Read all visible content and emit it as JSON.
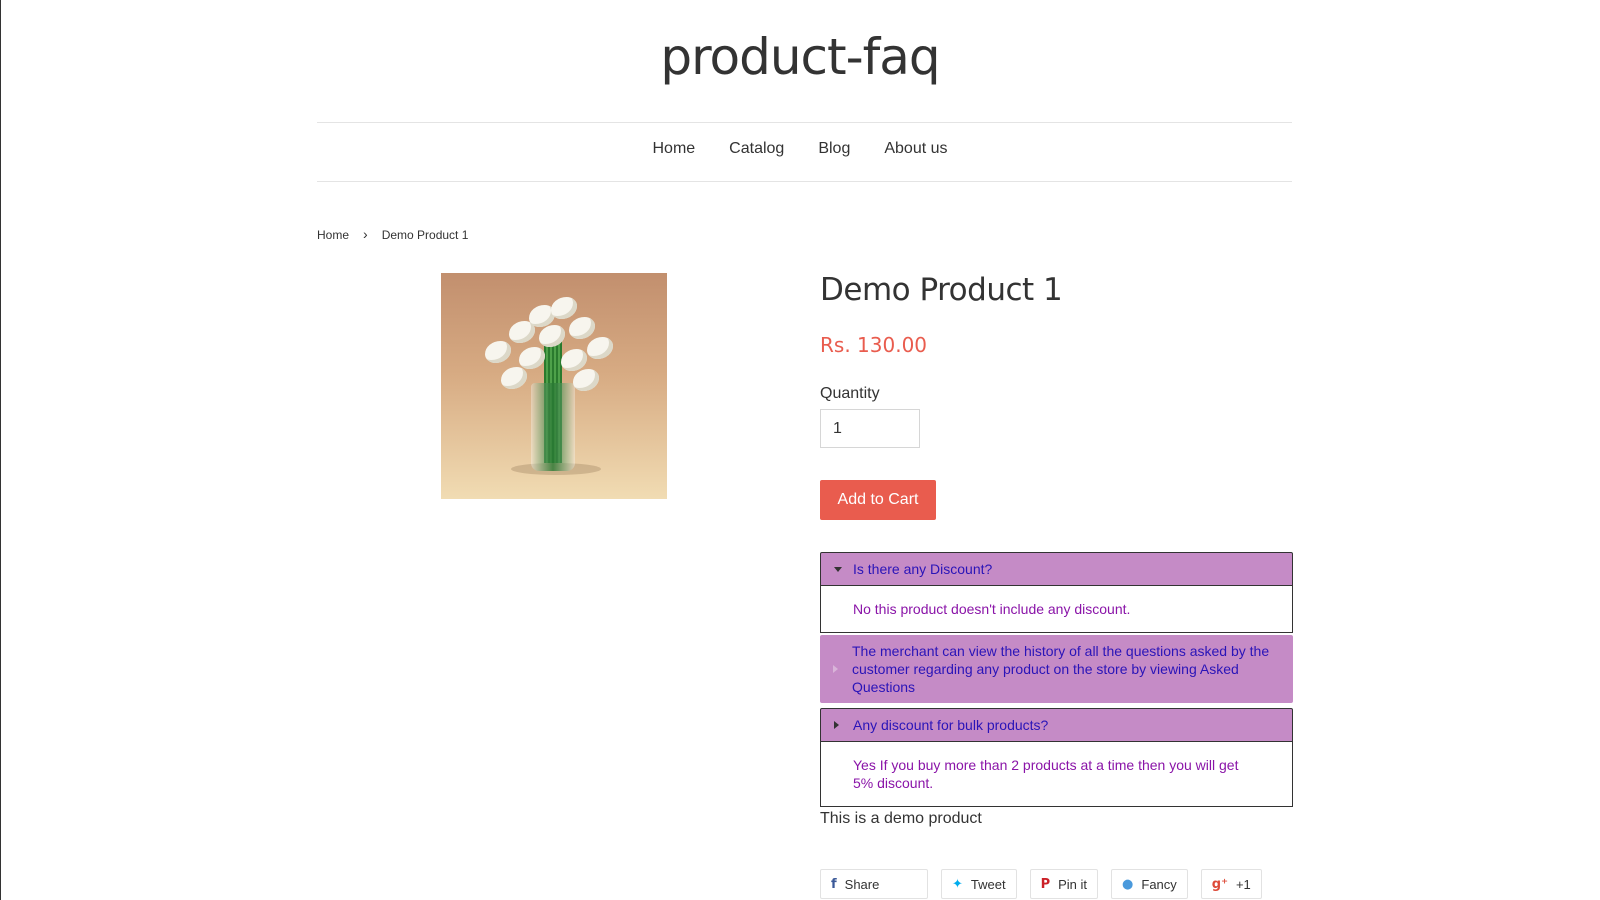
{
  "site": {
    "title": "product-faq"
  },
  "nav": {
    "items": [
      "Home",
      "Catalog",
      "Blog",
      "About us"
    ]
  },
  "breadcrumb": {
    "home": "Home",
    "separator": "›",
    "current": "Demo Product 1"
  },
  "product": {
    "title": "Demo Product 1",
    "price": "Rs. 130.00",
    "quantity_label": "Quantity",
    "quantity_value": "1",
    "add_to_cart": "Add to Cart",
    "description": "This is a demo product"
  },
  "faq": [
    {
      "question": "Is there any Discount?",
      "answer": "No this product doesn't include any discount.",
      "expanded": true
    },
    {
      "question": "The merchant can view the history of all the questions asked by the customer regarding any product on the store by viewing Asked Questions",
      "answer": "",
      "expanded": false
    },
    {
      "question": "Any discount for bulk products?",
      "answer": "Yes If you buy more than 2 products at a time then you will get 5% discount.",
      "expanded": true
    }
  ],
  "share": {
    "facebook": "Share",
    "twitter": "Tweet",
    "pinterest": "Pin it",
    "fancy": "Fancy",
    "google_plus": "+1"
  },
  "colors": {
    "accent": "#e95c4e",
    "faq_question_bg": "#c58bc6",
    "faq_question_text": "#2a14b8",
    "faq_answer_text": "#8a14a8"
  },
  "icons": {
    "facebook": "facebook-icon",
    "twitter": "twitter-icon",
    "pinterest": "pinterest-icon",
    "fancy": "fancy-icon",
    "google_plus": "google-plus-icon"
  }
}
